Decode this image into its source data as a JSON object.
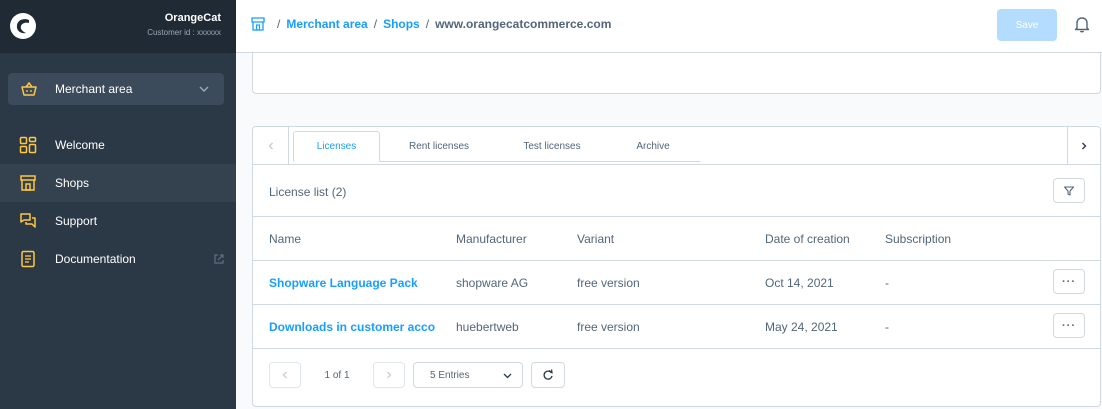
{
  "sidebar": {
    "org_name": "OrangeCat",
    "customer_id": "Customer id : xxxxxx",
    "merchant_selector": "Merchant area",
    "items": [
      {
        "label": "Welcome",
        "icon": "grid-icon"
      },
      {
        "label": "Shops",
        "icon": "storefront-icon"
      },
      {
        "label": "Support",
        "icon": "chat-icon"
      },
      {
        "label": "Documentation",
        "icon": "document-icon"
      }
    ]
  },
  "header": {
    "breadcrumbs": [
      "Merchant area",
      "Shops",
      "www.orangecatcommerce.com"
    ],
    "separator": "/",
    "save_label": "Save"
  },
  "tabs": [
    "Licenses",
    "Rent licenses",
    "Test licenses",
    "Archive"
  ],
  "license_list": {
    "title": "License list",
    "count": "(2)",
    "columns": [
      "Name",
      "Manufacturer",
      "Variant",
      "Date of creation",
      "Subscription"
    ],
    "rows": [
      {
        "name": "Shopware Language Pack",
        "manufacturer": "shopware AG",
        "variant": "free version",
        "date": "Oct 14, 2021",
        "subscription": "-"
      },
      {
        "name": "Downloads in customer accou...",
        "manufacturer": "huebertweb",
        "variant": "free version",
        "date": "May 24, 2021",
        "subscription": "-"
      }
    ],
    "row_action": "···"
  },
  "pagination": {
    "info": "1 of 1",
    "entries": "5 Entries"
  },
  "colors": {
    "accent": "#189eff",
    "sidebar": "#2b3947",
    "icon_yellow": "#ffc744"
  }
}
